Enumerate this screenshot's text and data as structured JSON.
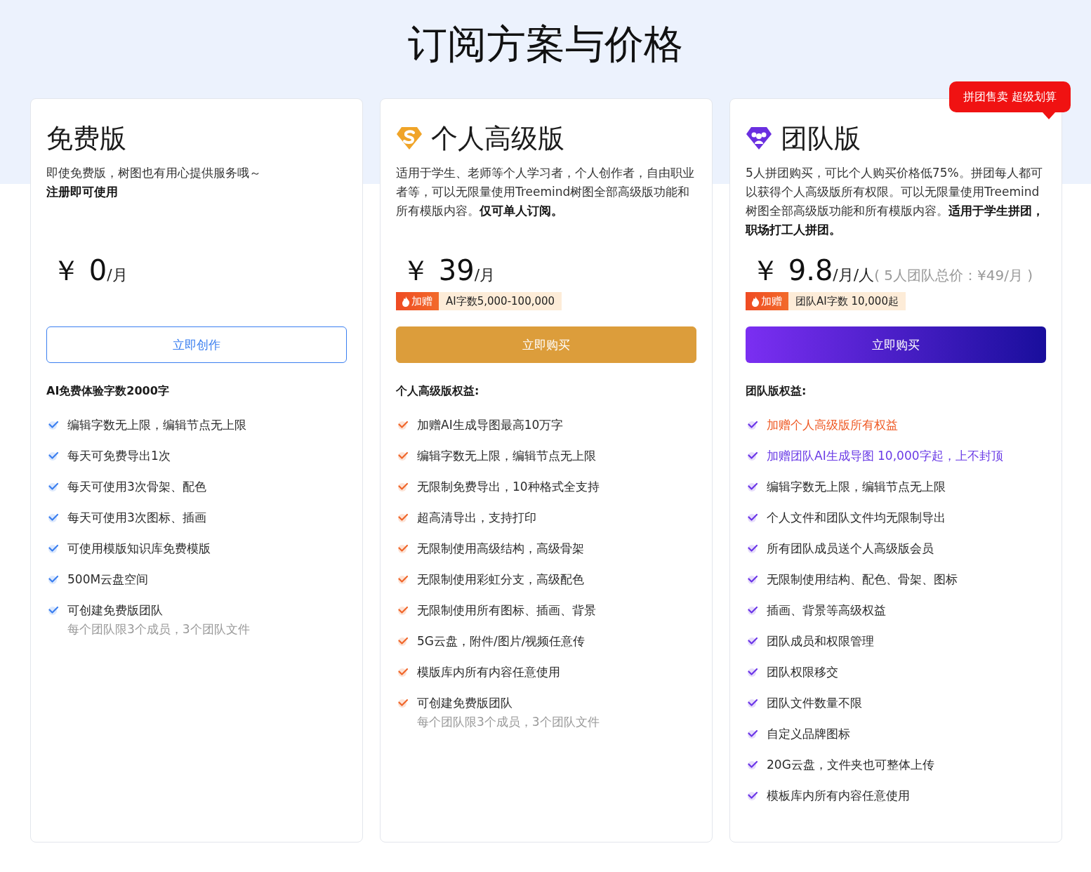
{
  "title": "订阅方案与价格",
  "plans": [
    {
      "kind": "free",
      "name": "免费版",
      "description": "即使免费版，树图也有用心提供服务哦～",
      "description_bold": "注册即可使用",
      "price": "￥ 0",
      "unit": "/月",
      "button": "立即创作",
      "benefits_heading": "AI免费体验字数2000字",
      "benefits": [
        {
          "text": "编辑字数无上限，编辑节点无上限",
          "kind": "normal"
        },
        {
          "text": "每天可免费导出1次",
          "kind": "normal"
        },
        {
          "text": "每天可使用3次骨架、配色",
          "kind": "normal"
        },
        {
          "text": "每天可使用3次图标、插画",
          "kind": "normal"
        },
        {
          "text": "可使用模版知识库免费模版",
          "kind": "normal"
        },
        {
          "text": "500M云盘空间",
          "kind": "normal"
        },
        {
          "text": "可创建免费版团队",
          "kind": "normal",
          "sub": "每个团队限3个成员，3个团队文件"
        }
      ]
    },
    {
      "kind": "personal",
      "name": "个人高级版",
      "description": "适用于学生、老师等个人学习者，个人创作者，自由职业者等，可以无限量使用Treemind树图全部高级版功能和所有模版内容。**仅可单人订阅。**",
      "price": "￥ 39",
      "unit": "/月",
      "bonus": {
        "tag": "加赠",
        "text": "AI字数5,000-100,000"
      },
      "button": "立即购买",
      "benefits_heading": "个人高级版权益:",
      "benefits": [
        {
          "text": "加赠AI生成导图最高10万字",
          "kind": "normal"
        },
        {
          "text": "编辑字数无上限，编辑节点无上限",
          "kind": "normal"
        },
        {
          "text": "无限制免费导出，10种格式全支持",
          "kind": "normal"
        },
        {
          "text": "超高清导出，支持打印",
          "kind": "normal"
        },
        {
          "text": "无限制使用高级结构，高级骨架",
          "kind": "normal"
        },
        {
          "text": "无限制使用彩虹分支，高级配色",
          "kind": "normal"
        },
        {
          "text": "无限制使用所有图标、插画、背景",
          "kind": "normal"
        },
        {
          "text": "5G云盘，附件/图片/视频任意传",
          "kind": "normal"
        },
        {
          "text": "模版库内所有内容任意使用",
          "kind": "normal"
        },
        {
          "text": "可创建免费版团队",
          "kind": "normal",
          "sub": "每个团队限3个成员，3个团队文件"
        }
      ]
    },
    {
      "kind": "team",
      "name": "团队版",
      "badge": "拼团售卖 超级划算",
      "description": "5人拼团购买，可比个人购买价格低75%。拼团每人都可以获得个人高级版所有权限。可以无限量使用Treemind树图全部高级版功能和所有模版内容。**适用于学生拼团，职场打工人拼团。**",
      "price": "￥ 9.8",
      "unit": "/月/人",
      "note": "( 5人团队总价：¥49/月 )",
      "bonus": {
        "tag": "加赠",
        "text": "团队AI字数 10,000起"
      },
      "button": "立即购买",
      "benefits_heading": "团队版权益:",
      "benefits": [
        {
          "text": "加赠个人高级版所有权益",
          "kind": "orange"
        },
        {
          "text": "加赠团队AI生成导图 10,000字起，上不封顶",
          "kind": "purple"
        },
        {
          "text": "编辑字数无上限，编辑节点无上限",
          "kind": "normal"
        },
        {
          "text": "个人文件和团队文件均无限制导出",
          "kind": "normal"
        },
        {
          "text": "所有团队成员送个人高级版会员",
          "kind": "normal"
        },
        {
          "text": "无限制使用结构、配色、骨架、图标",
          "kind": "normal"
        },
        {
          "text": "插画、背景等高级权益",
          "kind": "normal"
        },
        {
          "text": "团队成员和权限管理",
          "kind": "normal"
        },
        {
          "text": "团队权限移交",
          "kind": "normal"
        },
        {
          "text": "团队文件数量不限",
          "kind": "normal"
        },
        {
          "text": "自定义品牌图标",
          "kind": "normal"
        },
        {
          "text": "20G云盘，文件夹也可整体上传",
          "kind": "normal"
        },
        {
          "text": "模板库内所有内容任意使用",
          "kind": "normal"
        }
      ]
    }
  ]
}
